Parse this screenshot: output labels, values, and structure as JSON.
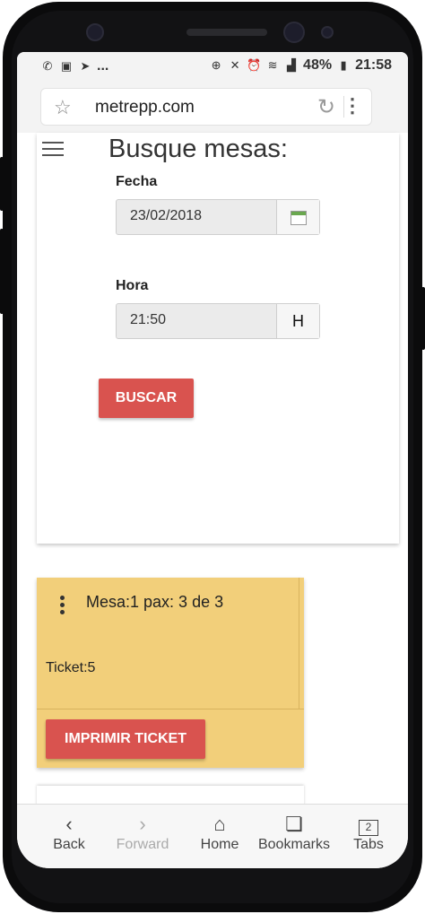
{
  "status_bar": {
    "battery": "48%",
    "time": "21:58",
    "notif_more": "..."
  },
  "browser": {
    "url": "metrepp.com"
  },
  "search": {
    "title": "Busque mesas:",
    "date_label": "Fecha",
    "date_value": "23/02/2018",
    "time_label": "Hora",
    "time_value": "21:50",
    "time_addon": "H",
    "search_button": "BUSCAR"
  },
  "table_card": {
    "heading": "Mesa:1 pax: 3 de 3",
    "ticket": "Ticket:5",
    "print_button": "IMPRIMIR TICKET",
    "background": "#f2cf7a"
  },
  "accent": "#d9534f",
  "bottom_nav": [
    {
      "label": "Back",
      "icon": "back-icon"
    },
    {
      "label": "Forward",
      "icon": "forward-icon"
    },
    {
      "label": "Home",
      "icon": "home-icon"
    },
    {
      "label": "Bookmarks",
      "icon": "bookmarks-icon"
    },
    {
      "label": "Tabs",
      "icon": "tabs-icon",
      "count": "2"
    }
  ]
}
